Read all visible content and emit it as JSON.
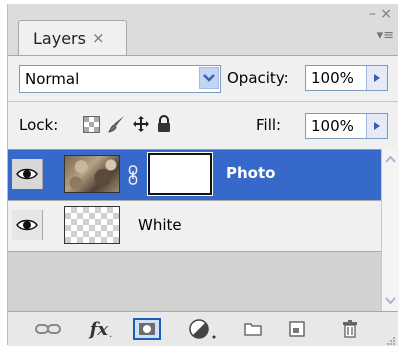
{
  "panel": {
    "tab_label": "Layers",
    "tab_close": "×",
    "collapse_glyph": "–",
    "close_glyph": "×",
    "menu_glyph": "▾≡"
  },
  "blend": {
    "mode": "Normal",
    "opacity_label": "Opacity:",
    "opacity_value": "100%"
  },
  "lock": {
    "label": "Lock:",
    "fill_label": "Fill:",
    "fill_value": "100%"
  },
  "layers": [
    {
      "name": "Photo",
      "selected": true,
      "has_mask": true
    },
    {
      "name": "White",
      "selected": false,
      "has_mask": false
    }
  ],
  "colors": {
    "selection": "#3669c9",
    "panel_bg": "#d8d8d8"
  },
  "icons": {
    "toolbar": [
      "link-layers-icon",
      "layer-style-fx-icon",
      "add-mask-icon",
      "adjustment-layer-icon",
      "new-group-icon",
      "new-layer-icon",
      "delete-layer-icon"
    ],
    "fx_label": "fx"
  }
}
